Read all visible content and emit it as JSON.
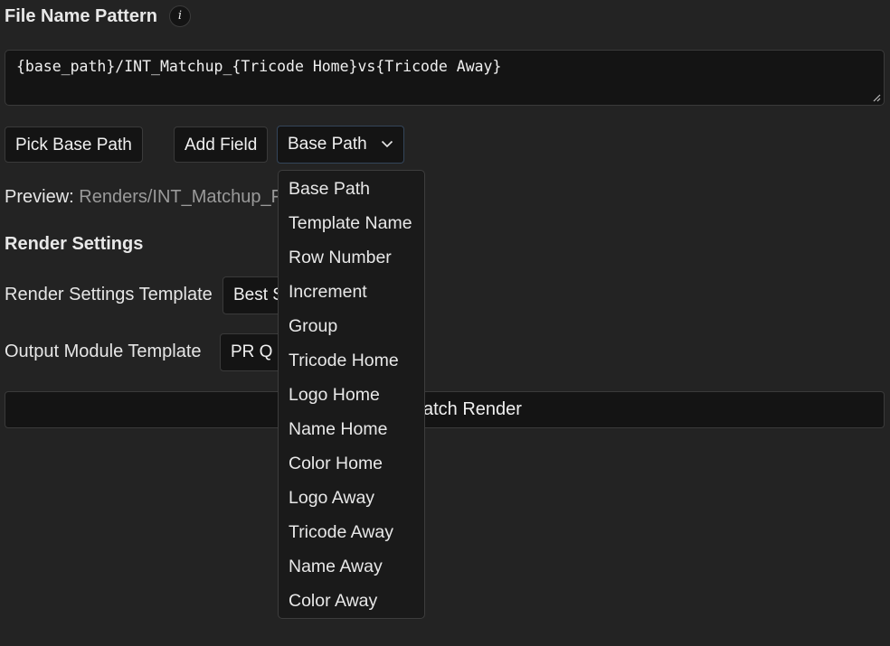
{
  "file_name_pattern": {
    "title": "File Name Pattern",
    "info_glyph": "i",
    "value": "{base_path}/INT_Matchup_{Tricode Home}vs{Tricode Away}"
  },
  "toolbar": {
    "pick_base_path_label": "Pick Base Path",
    "add_field_label": "Add Field",
    "field_select_value": "Base Path"
  },
  "preview": {
    "label": "Preview:",
    "value": "Renders/INT_Matchup_F"
  },
  "render_settings": {
    "title": "Render Settings",
    "render_settings_template_label": "Render Settings Template",
    "render_settings_template_value": "Best S",
    "output_module_template_label": "Output Module Template",
    "output_module_template_value": "PR Q"
  },
  "batch_render": {
    "label_visible": "atch Render"
  },
  "field_dropdown": {
    "options": [
      "Base Path",
      "Template Name",
      "Row Number",
      "Increment",
      "Group",
      "Tricode Home",
      "Logo Home",
      "Name Home",
      "Color Home",
      "Logo Away",
      "Tricode Away",
      "Name Away",
      "Color Away"
    ]
  },
  "colors": {
    "background": "#232323",
    "input_background": "#141414",
    "border": "#3a3a3a",
    "text": "#e6e6e6",
    "muted_text": "#9a9a9a"
  },
  "icons": {
    "info": "info-icon",
    "chevron": "chevron-down-icon",
    "resize": "resize-grip-icon"
  }
}
